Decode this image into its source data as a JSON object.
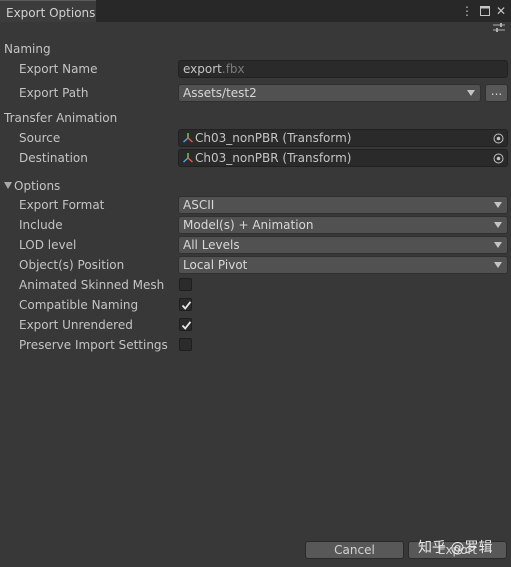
{
  "window": {
    "tab_title": "Export Options"
  },
  "naming": {
    "section_label": "Naming",
    "export_name_label": "Export Name",
    "export_name_value": "export",
    "export_name_ext": ".fbx",
    "export_path_label": "Export Path",
    "export_path_value": "Assets/test2",
    "browse_label": "..."
  },
  "transfer": {
    "section_label": "Transfer Animation",
    "source_label": "Source",
    "source_value": "Ch03_nonPBR (Transform)",
    "destination_label": "Destination",
    "destination_value": "Ch03_nonPBR (Transform)"
  },
  "options": {
    "section_label": "Options",
    "export_format_label": "Export Format",
    "export_format_value": "ASCII",
    "include_label": "Include",
    "include_value": "Model(s) + Animation",
    "lod_label": "LOD level",
    "lod_value": "All Levels",
    "position_label": "Object(s) Position",
    "position_value": "Local Pivot",
    "animated_skinned_label": "Animated Skinned Mesh",
    "animated_skinned_checked": false,
    "compatible_naming_label": "Compatible Naming",
    "compatible_naming_checked": true,
    "export_unrendered_label": "Export Unrendered",
    "export_unrendered_checked": true,
    "preserve_import_label": "Preserve Import Settings",
    "preserve_import_checked": false
  },
  "footer": {
    "cancel_label": "Cancel",
    "export_label": "Export"
  },
  "watermark": "知乎 @罗辑",
  "icons": {
    "kebab": "kebab-menu-icon",
    "maximize": "maximize-icon",
    "close": "close-icon",
    "settings": "settings-sliders-icon",
    "object": "transform-gizmo-icon",
    "target": "object-picker-icon",
    "check": "checkmark-icon",
    "dropdown": "dropdown-arrow-icon"
  }
}
